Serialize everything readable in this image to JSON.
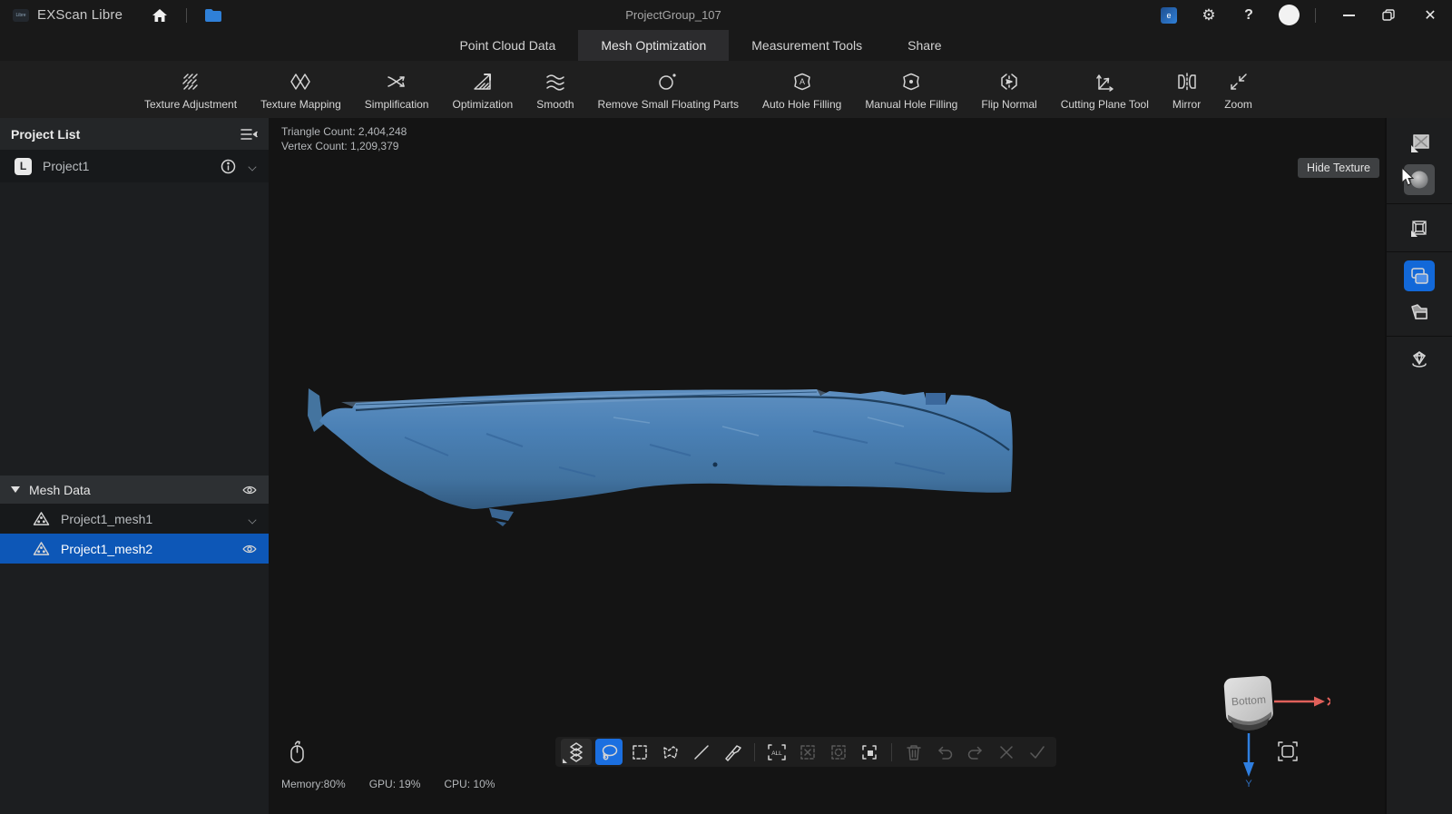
{
  "titlebar": {
    "app_name": "EXScan Libre",
    "project_title": "ProjectGroup_107",
    "account_badge": "e"
  },
  "tabs": [
    {
      "label": "Point Cloud Data",
      "active": false
    },
    {
      "label": "Mesh Optimization",
      "active": true
    },
    {
      "label": "Measurement Tools",
      "active": false
    },
    {
      "label": "Share",
      "active": false
    }
  ],
  "ribbon": {
    "tools": [
      {
        "label": "Texture Adjustment",
        "icon": "texture-adjustment-icon"
      },
      {
        "label": "Texture Mapping",
        "icon": "texture-mapping-icon"
      },
      {
        "label": "Simplification",
        "icon": "simplification-icon"
      },
      {
        "label": "Optimization",
        "icon": "optimization-icon"
      },
      {
        "label": "Smooth",
        "icon": "smooth-icon"
      },
      {
        "label": "Remove Small Floating Parts",
        "icon": "remove-floating-parts-icon"
      },
      {
        "label": "Auto Hole Filling",
        "icon": "auto-hole-filling-icon"
      },
      {
        "label": "Manual Hole Filling",
        "icon": "manual-hole-filling-icon"
      },
      {
        "label": "Flip Normal",
        "icon": "flip-normal-icon"
      },
      {
        "label": "Cutting Plane Tool",
        "icon": "cutting-plane-icon"
      },
      {
        "label": "Mirror",
        "icon": "mirror-icon"
      },
      {
        "label": "Zoom",
        "icon": "zoom-icon"
      }
    ]
  },
  "sidebar": {
    "project_list_title": "Project List",
    "project": {
      "badge": "L",
      "name": "Project1"
    },
    "mesh_header": "Mesh Data",
    "mesh_items": [
      {
        "label": "Project1_mesh1",
        "selected": false
      },
      {
        "label": "Project1_mesh2",
        "selected": true
      }
    ]
  },
  "viewport": {
    "triangle_count": "Triangle Count: 2,404,248",
    "vertex_count": "Vertex Count: 1,209,379",
    "hide_texture_tooltip": "Hide Texture",
    "nav_cube": {
      "face_label": "Bottom",
      "axis_y_label": "Y"
    }
  },
  "bottom_toolbar": {
    "select_all_text": "ALL"
  },
  "statusbar": {
    "memory": "Memory:80%",
    "gpu": "GPU: 19%",
    "cpu": "CPU: 10%"
  },
  "colors": {
    "accent_blue": "#1b6fe0",
    "selection_row_blue": "#0d57b7",
    "mesh_blue": "#4a80b5",
    "axis_x_red": "#e0605a",
    "axis_y_blue": "#2f7fe0"
  }
}
